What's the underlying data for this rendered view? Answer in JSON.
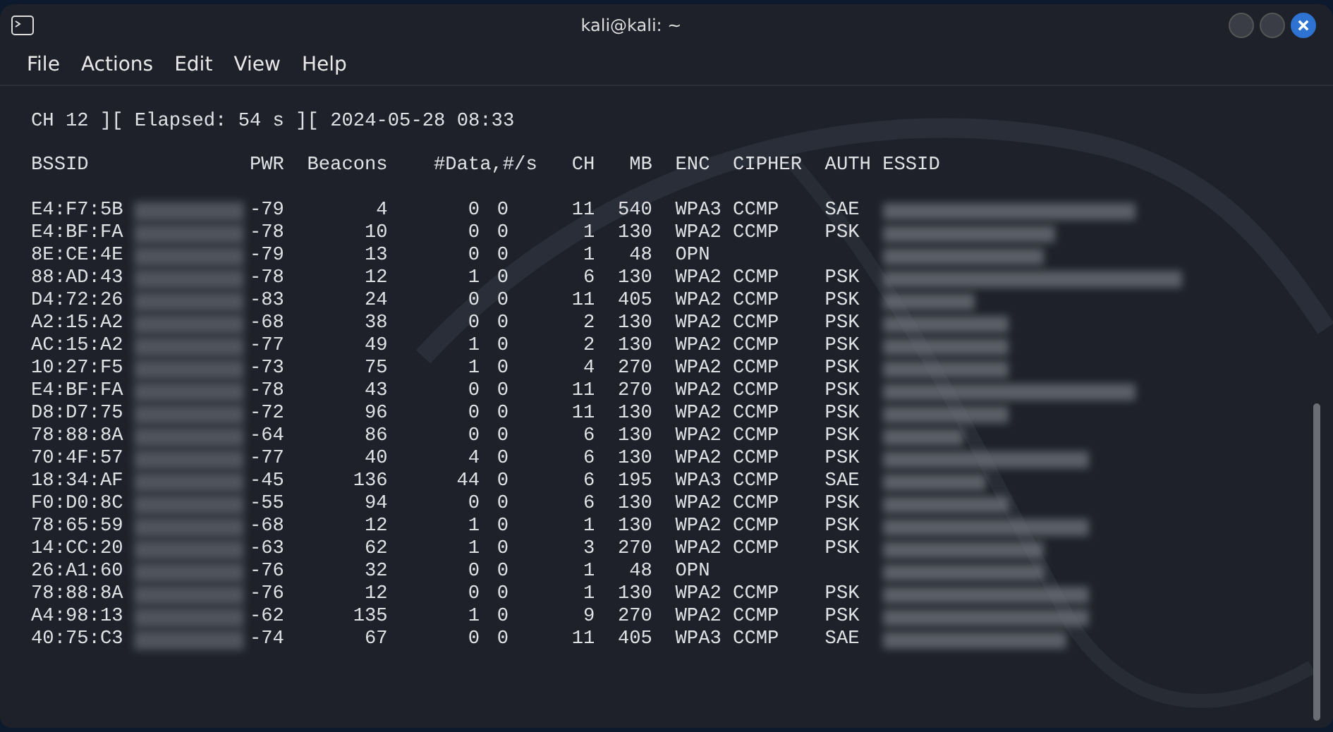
{
  "window": {
    "title": "kali@kali: ~"
  },
  "menu": [
    "File",
    "Actions",
    "Edit",
    "View",
    "Help"
  ],
  "status_line": "CH 12 ][ Elapsed: 54 s ][ 2024-05-28 08:33",
  "columns": [
    "BSSID",
    "PWR",
    "Beacons",
    "#Data,",
    "#/s",
    "CH",
    "MB",
    "ENC",
    "CIPHER",
    "AUTH",
    "ESSID"
  ],
  "rows": [
    {
      "bssid": "E4:F7:5B",
      "pwr": "-79",
      "beacons": "4",
      "data": "0",
      "rate": "0",
      "ch": "11",
      "mb": "540",
      "enc": "WPA3",
      "cipher": "CCMP",
      "auth": "SAE"
    },
    {
      "bssid": "E4:BF:FA",
      "pwr": "-78",
      "beacons": "10",
      "data": "0",
      "rate": "0",
      "ch": "1",
      "mb": "130",
      "enc": "WPA2",
      "cipher": "CCMP",
      "auth": "PSK"
    },
    {
      "bssid": "8E:CE:4E",
      "pwr": "-79",
      "beacons": "13",
      "data": "0",
      "rate": "0",
      "ch": "1",
      "mb": "48",
      "enc": "OPN"
    },
    {
      "bssid": "88:AD:43",
      "pwr": "-78",
      "beacons": "12",
      "data": "1",
      "rate": "0",
      "ch": "6",
      "mb": "130",
      "enc": "WPA2",
      "cipher": "CCMP",
      "auth": "PSK"
    },
    {
      "bssid": "D4:72:26",
      "pwr": "-83",
      "beacons": "24",
      "data": "0",
      "rate": "0",
      "ch": "11",
      "mb": "405",
      "enc": "WPA2",
      "cipher": "CCMP",
      "auth": "PSK"
    },
    {
      "bssid": "A2:15:A2",
      "pwr": "-68",
      "beacons": "38",
      "data": "0",
      "rate": "0",
      "ch": "2",
      "mb": "130",
      "enc": "WPA2",
      "cipher": "CCMP",
      "auth": "PSK"
    },
    {
      "bssid": "AC:15:A2",
      "pwr": "-77",
      "beacons": "49",
      "data": "1",
      "rate": "0",
      "ch": "2",
      "mb": "130",
      "enc": "WPA2",
      "cipher": "CCMP",
      "auth": "PSK"
    },
    {
      "bssid": "10:27:F5",
      "pwr": "-73",
      "beacons": "75",
      "data": "1",
      "rate": "0",
      "ch": "4",
      "mb": "270",
      "enc": "WPA2",
      "cipher": "CCMP",
      "auth": "PSK"
    },
    {
      "bssid": "E4:BF:FA",
      "pwr": "-78",
      "beacons": "43",
      "data": "0",
      "rate": "0",
      "ch": "11",
      "mb": "270",
      "enc": "WPA2",
      "cipher": "CCMP",
      "auth": "PSK"
    },
    {
      "bssid": "D8:D7:75",
      "pwr": "-72",
      "beacons": "96",
      "data": "0",
      "rate": "0",
      "ch": "11",
      "mb": "130",
      "enc": "WPA2",
      "cipher": "CCMP",
      "auth": "PSK"
    },
    {
      "bssid": "78:88:8A",
      "pwr": "-64",
      "beacons": "86",
      "data": "0",
      "rate": "0",
      "ch": "6",
      "mb": "130",
      "enc": "WPA2",
      "cipher": "CCMP",
      "auth": "PSK"
    },
    {
      "bssid": "70:4F:57",
      "pwr": "-77",
      "beacons": "40",
      "data": "4",
      "rate": "0",
      "ch": "6",
      "mb": "130",
      "enc": "WPA2",
      "cipher": "CCMP",
      "auth": "PSK"
    },
    {
      "bssid": "18:34:AF",
      "pwr": "-45",
      "beacons": "136",
      "data": "44",
      "rate": "0",
      "ch": "6",
      "mb": "195",
      "enc": "WPA3",
      "cipher": "CCMP",
      "auth": "SAE"
    },
    {
      "bssid": "F0:D0:8C",
      "pwr": "-55",
      "beacons": "94",
      "data": "0",
      "rate": "0",
      "ch": "6",
      "mb": "130",
      "enc": "WPA2",
      "cipher": "CCMP",
      "auth": "PSK"
    },
    {
      "bssid": "78:65:59",
      "pwr": "-68",
      "beacons": "12",
      "data": "1",
      "rate": "0",
      "ch": "1",
      "mb": "130",
      "enc": "WPA2",
      "cipher": "CCMP",
      "auth": "PSK"
    },
    {
      "bssid": "14:CC:20",
      "pwr": "-63",
      "beacons": "62",
      "data": "1",
      "rate": "0",
      "ch": "3",
      "mb": "270",
      "enc": "WPA2",
      "cipher": "CCMP",
      "auth": "PSK"
    },
    {
      "bssid": "26:A1:60",
      "pwr": "-76",
      "beacons": "32",
      "data": "0",
      "rate": "0",
      "ch": "1",
      "mb": "48",
      "enc": "OPN"
    },
    {
      "bssid": "78:88:8A",
      "pwr": "-76",
      "beacons": "12",
      "data": "0",
      "rate": "0",
      "ch": "1",
      "mb": "130",
      "enc": "WPA2",
      "cipher": "CCMP",
      "auth": "PSK"
    },
    {
      "bssid": "A4:98:13",
      "pwr": "-62",
      "beacons": "135",
      "data": "1",
      "rate": "0",
      "ch": "9",
      "mb": "270",
      "enc": "WPA2",
      "cipher": "CCMP",
      "auth": "PSK"
    },
    {
      "bssid": "40:75:C3",
      "pwr": "-74",
      "beacons": "67",
      "data": "0",
      "rate": "0",
      "ch": "11",
      "mb": "405",
      "enc": "WPA3",
      "cipher": "CCMP",
      "auth": "SAE"
    }
  ]
}
